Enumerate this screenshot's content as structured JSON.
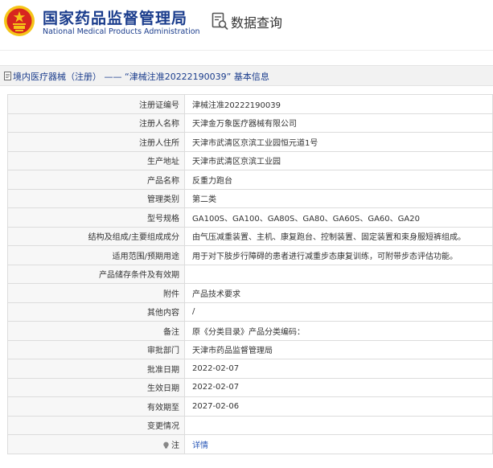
{
  "header": {
    "agency_cn": "国家药品监督管理局",
    "agency_en": "National Medical Products Administration",
    "search_label": "数据查询"
  },
  "section": {
    "title": "境内医疗器械（注册） —— “津械注准20222190039” 基本信息"
  },
  "colors": {
    "brand_blue": "#1a3c8c",
    "emblem_red": "#d7261f",
    "emblem_gold": "#f5c518",
    "link_blue": "#2a58b8"
  },
  "rows": [
    {
      "label": "注册证编号",
      "value": "津械注准20222190039"
    },
    {
      "label": "注册人名称",
      "value": "天津金万象医疗器械有限公司"
    },
    {
      "label": "注册人住所",
      "value": "天津市武清区京滨工业园恒元道1号"
    },
    {
      "label": "生产地址",
      "value": "天津市武清区京滨工业园"
    },
    {
      "label": "产品名称",
      "value": "反重力跑台"
    },
    {
      "label": "管理类别",
      "value": "第二类"
    },
    {
      "label": "型号规格",
      "value": "GA100S、GA100、GA80S、GA80、GA60S、GA60、GA20"
    },
    {
      "label": "结构及组成/主要组成成分",
      "value": "由气压减重装置、主机、康复跑台、控制装置、固定装置和束身服短裤组成。"
    },
    {
      "label": "适用范围/预期用途",
      "value": "用于对下肢步行障碍的患者进行减重步态康复训练，可附带步态评估功能。"
    },
    {
      "label": "产品储存条件及有效期",
      "value": ""
    },
    {
      "label": "附件",
      "value": "产品技术要求"
    },
    {
      "label": "其他内容",
      "value": "/"
    },
    {
      "label": "备注",
      "value": "原《分类目录》产品分类编码："
    },
    {
      "label": "审批部门",
      "value": "天津市药品监督管理局"
    },
    {
      "label": "批准日期",
      "value": "2022-02-07"
    },
    {
      "label": "生效日期",
      "value": "2022-02-07"
    },
    {
      "label": "有效期至",
      "value": "2027-02-06"
    },
    {
      "label": "变更情况",
      "value": ""
    }
  ],
  "note_row": {
    "label": "注",
    "link_label": "详情",
    "icon": "bulb-icon"
  }
}
